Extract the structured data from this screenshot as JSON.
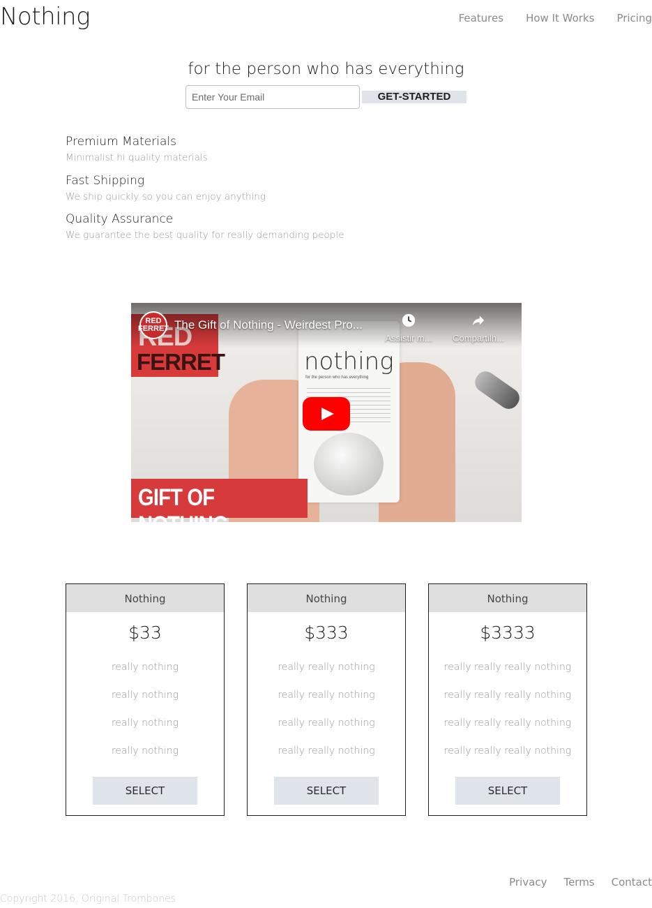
{
  "header": {
    "logo": "Nothing",
    "nav": [
      "Features",
      "How It Works",
      "Pricing"
    ]
  },
  "hero": {
    "title": "for the person who has everything",
    "email_placeholder": "Enter Your Email",
    "cta_label": "GET-STARTED"
  },
  "features": [
    {
      "title": "Premium Materials",
      "desc": "Minimalist hi quality materials"
    },
    {
      "title": "Fast Shipping",
      "desc": "We ship quickly so you can enjoy anything"
    },
    {
      "title": "Quality Assurance",
      "desc": "We guarantee the best quality for really demanding people"
    }
  ],
  "video": {
    "title": "The Gift of Nothing - Weirdest Pro...",
    "watch_later_label": "Assistir m...",
    "share_label": "Compartilh...",
    "channel_avatar_top": "RED",
    "channel_avatar_bottom": "FERRET",
    "thumb_text_top": "RED",
    "thumb_text_bottom": "FERRET",
    "product_word": "nothing",
    "product_tagline": "for the person who has everything",
    "banner_text": "GIFT OF NOTHING",
    "play_color": "#ff0000"
  },
  "pricing": [
    {
      "name": "Nothing",
      "price": "$33",
      "features": [
        "really nothing",
        "really nothing",
        "really nothing",
        "really nothing"
      ],
      "button": "SELECT"
    },
    {
      "name": "Nothing",
      "price": "$333",
      "features": [
        "really really nothing",
        "really really nothing",
        "really really nothing",
        "really really nothing"
      ],
      "button": "SELECT"
    },
    {
      "name": "Nothing",
      "price": "$3333",
      "features": [
        "really really really nothing",
        "really really really nothing",
        "really really really nothing",
        "really really really nothing"
      ],
      "button": "SELECT"
    }
  ],
  "footer": {
    "links": [
      "Privacy",
      "Terms",
      "Contact"
    ],
    "copyright": "Copyright 2016, Original Trombones"
  },
  "colors": {
    "button_bg": "#dfe3ea",
    "plan_header_bg": "#dfdfdf",
    "muted_text": "#9a9a9a",
    "video_banner": "#d63a3a"
  }
}
